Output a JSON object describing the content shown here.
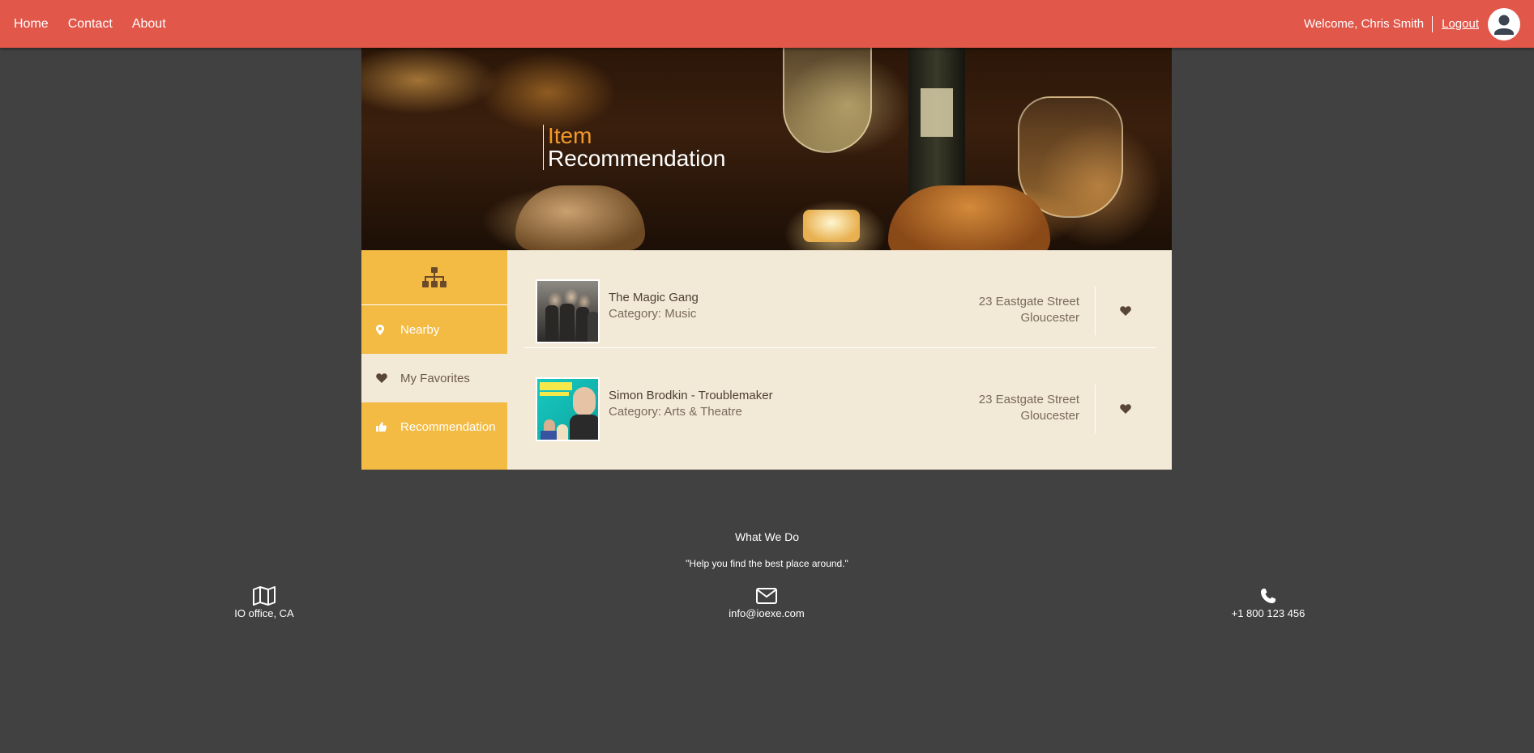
{
  "nav": {
    "links": [
      "Home",
      "Contact",
      "About"
    ],
    "welcome": "Welcome, Chris Smith",
    "logout": "Logout"
  },
  "hero": {
    "title_line1": "Item",
    "title_line2": "Recommendation"
  },
  "sidebar": {
    "items": [
      {
        "label": "Nearby",
        "icon": "map-marker-icon"
      },
      {
        "label": "My Favorites",
        "icon": "heart-icon"
      },
      {
        "label": "Recommendation",
        "icon": "thumbs-up-icon"
      }
    ],
    "active_index": 1
  },
  "items": [
    {
      "name": "The Magic Gang",
      "category": "Category: Music",
      "address_line1": "23 Eastgate Street",
      "address_line2": "Gloucester"
    },
    {
      "name": "Simon Brodkin - Troublemaker",
      "category": "Category: Arts & Theatre",
      "address_line1": "23 Eastgate Street",
      "address_line2": "Gloucester"
    }
  ],
  "footer": {
    "title": "What We Do",
    "quote": "\"Help you find the best place around.\"",
    "contacts": [
      {
        "icon": "map-icon",
        "text": "IO office, CA"
      },
      {
        "icon": "envelope-icon",
        "text": "info@ioexe.com"
      },
      {
        "icon": "phone-icon",
        "text": "+1 800 123 456"
      }
    ]
  },
  "colors": {
    "nav_bg": "#e1574a",
    "page_bg": "#414141",
    "sidebar_bg": "#f3bb44",
    "panel_bg": "#f3e9d7",
    "hero_accent": "#f39a2c"
  }
}
